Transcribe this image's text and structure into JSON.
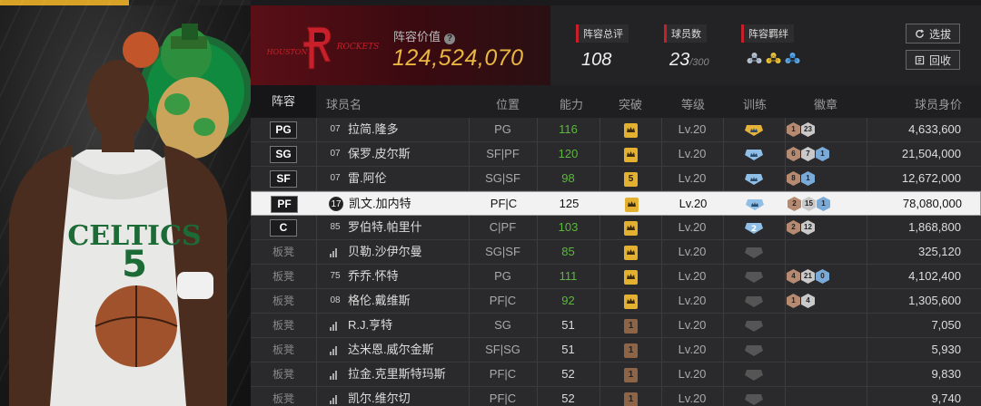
{
  "team": {
    "logo_text": "HOUSTON ROCKETS",
    "value_label": "阵容价值",
    "value": "124,524,070"
  },
  "stats": {
    "rating_label": "阵容总评",
    "rating": "108",
    "players_label": "球员数",
    "players": "23",
    "players_max": "/300",
    "chemistry_label": "阵容羁绊",
    "chemistry_icons": [
      "chemistry-silver-icon",
      "chemistry-gold-icon",
      "chemistry-blue-icon"
    ]
  },
  "buttons": {
    "select": "选拔",
    "recycle": "回收"
  },
  "columns": [
    "阵容",
    "球员名",
    "位置",
    "能力",
    "突破",
    "等级",
    "训练",
    "徽章",
    "球员身价"
  ],
  "rows": [
    {
      "slot": "PG",
      "num": "07",
      "name": "拉简.隆多",
      "pos": "PG",
      "ability": "116",
      "break": "",
      "breakType": "gold",
      "level": "Lv.20",
      "train": "gold",
      "train_val": "",
      "badges": [
        {
          "v": "1",
          "t": "bronze"
        },
        {
          "v": "23",
          "t": "silver"
        }
      ],
      "value": "4,633,600"
    },
    {
      "slot": "SG",
      "num": "07",
      "name": "保罗.皮尔斯",
      "pos": "SF|PF",
      "ability": "120",
      "break": "",
      "breakType": "gold",
      "level": "Lv.20",
      "train": "blue",
      "train_val": "",
      "badges": [
        {
          "v": "6",
          "t": "bronze"
        },
        {
          "v": "7",
          "t": "silver"
        },
        {
          "v": "1",
          "t": "blue"
        }
      ],
      "value": "21,504,000"
    },
    {
      "slot": "SF",
      "num": "07",
      "name": "雷.阿伦",
      "pos": "SG|SF",
      "ability": "98",
      "break": "5",
      "breakType": "gold",
      "level": "Lv.20",
      "train": "blue",
      "train_val": "",
      "badges": [
        {
          "v": "8",
          "t": "bronze"
        },
        {
          "v": "1",
          "t": "blue"
        }
      ],
      "value": "12,672,000"
    },
    {
      "slot": "PF",
      "num": "17",
      "name": "凯文.加内特",
      "pos": "PF|C",
      "ability": "125",
      "break": "",
      "breakType": "gold",
      "level": "Lv.20",
      "train": "blue",
      "train_val": "",
      "badges": [
        {
          "v": "2",
          "t": "bronze"
        },
        {
          "v": "15",
          "t": "silver"
        },
        {
          "v": "1",
          "t": "blue"
        }
      ],
      "value": "78,080,000",
      "selected": true
    },
    {
      "slot": "C",
      "num": "85",
      "name": "罗伯特.帕里什",
      "pos": "C|PF",
      "ability": "103",
      "break": "",
      "breakType": "gold",
      "level": "Lv.20",
      "train": "blue",
      "train_val": "2",
      "badges": [
        {
          "v": "2",
          "t": "bronze"
        },
        {
          "v": "12",
          "t": "silver"
        }
      ],
      "value": "1,868,800"
    },
    {
      "slot": "板凳",
      "num": "",
      "name": "贝勒.沙伊尔曼",
      "pos": "SG|SF",
      "ability": "85",
      "break": "",
      "breakType": "gold",
      "level": "Lv.20",
      "train": "gray",
      "train_val": "",
      "badges": [],
      "value": "325,120"
    },
    {
      "slot": "板凳",
      "num": "75",
      "name": "乔乔.怀特",
      "pos": "PG",
      "ability": "111",
      "break": "",
      "breakType": "gold",
      "level": "Lv.20",
      "train": "gray",
      "train_val": "",
      "badges": [
        {
          "v": "4",
          "t": "bronze"
        },
        {
          "v": "21",
          "t": "silver"
        },
        {
          "v": "0",
          "t": "blue"
        }
      ],
      "value": "4,102,400"
    },
    {
      "slot": "板凳",
      "num": "08",
      "name": "格伦.戴维斯",
      "pos": "PF|C",
      "ability": "92",
      "break": "",
      "breakType": "gold",
      "level": "Lv.20",
      "train": "gray",
      "train_val": "",
      "badges": [
        {
          "v": "1",
          "t": "bronze"
        },
        {
          "v": "4",
          "t": "silver"
        }
      ],
      "value": "1,305,600"
    },
    {
      "slot": "板凳",
      "num": "",
      "name": "R.J.亨特",
      "pos": "SG",
      "ability": "51",
      "break": "1",
      "breakType": "bronze",
      "level": "Lv.20",
      "train": "gray",
      "train_val": "",
      "badges": [],
      "value": "7,050"
    },
    {
      "slot": "板凳",
      "num": "",
      "name": "达米恩.威尔金斯",
      "pos": "SF|SG",
      "ability": "51",
      "break": "1",
      "breakType": "bronze",
      "level": "Lv.20",
      "train": "gray",
      "train_val": "",
      "badges": [],
      "value": "5,930"
    },
    {
      "slot": "板凳",
      "num": "",
      "name": "拉金.克里斯特玛斯",
      "pos": "PF|C",
      "ability": "52",
      "break": "1",
      "breakType": "bronze",
      "level": "Lv.20",
      "train": "gray",
      "train_val": "",
      "badges": [],
      "value": "9,830"
    },
    {
      "slot": "板凳",
      "num": "",
      "name": "凯尔.维尔切",
      "pos": "PF|C",
      "ability": "52",
      "break": "1",
      "breakType": "bronze",
      "level": "Lv.20",
      "train": "gray",
      "train_val": "",
      "badges": [],
      "value": "9,740"
    }
  ],
  "colors": {
    "accent_gold": "#e9b640",
    "team_red": "#5a0f16",
    "ability_green": "#5cb83c",
    "selected_row": "#f2f2f2"
  }
}
